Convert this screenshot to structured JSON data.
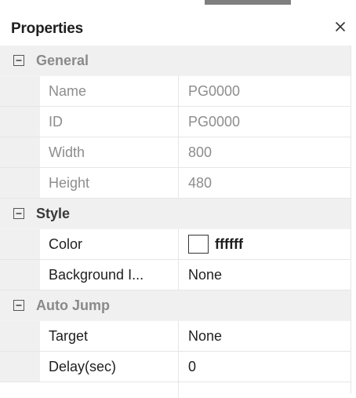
{
  "panel": {
    "title": "Properties",
    "close_icon": "close-icon"
  },
  "groups": [
    {
      "label": "General",
      "toggle_symbol": "minus-box",
      "properties": [
        {
          "name": "Name",
          "value": "PG0000"
        },
        {
          "name": "ID",
          "value": "PG0000"
        },
        {
          "name": "Width",
          "value": "800"
        },
        {
          "name": "Height",
          "value": "480"
        }
      ]
    },
    {
      "label": "Style",
      "toggle_symbol": "minus-box",
      "properties": [
        {
          "name": "Color",
          "value": "ffffff",
          "swatch_color": "#ffffff"
        },
        {
          "name": "Background I...",
          "value": "None"
        }
      ]
    },
    {
      "label": "Auto Jump",
      "toggle_symbol": "minus-box",
      "properties": [
        {
          "name": "Target",
          "value": "None"
        },
        {
          "name": "Delay(sec)",
          "value": "0"
        }
      ]
    }
  ]
}
